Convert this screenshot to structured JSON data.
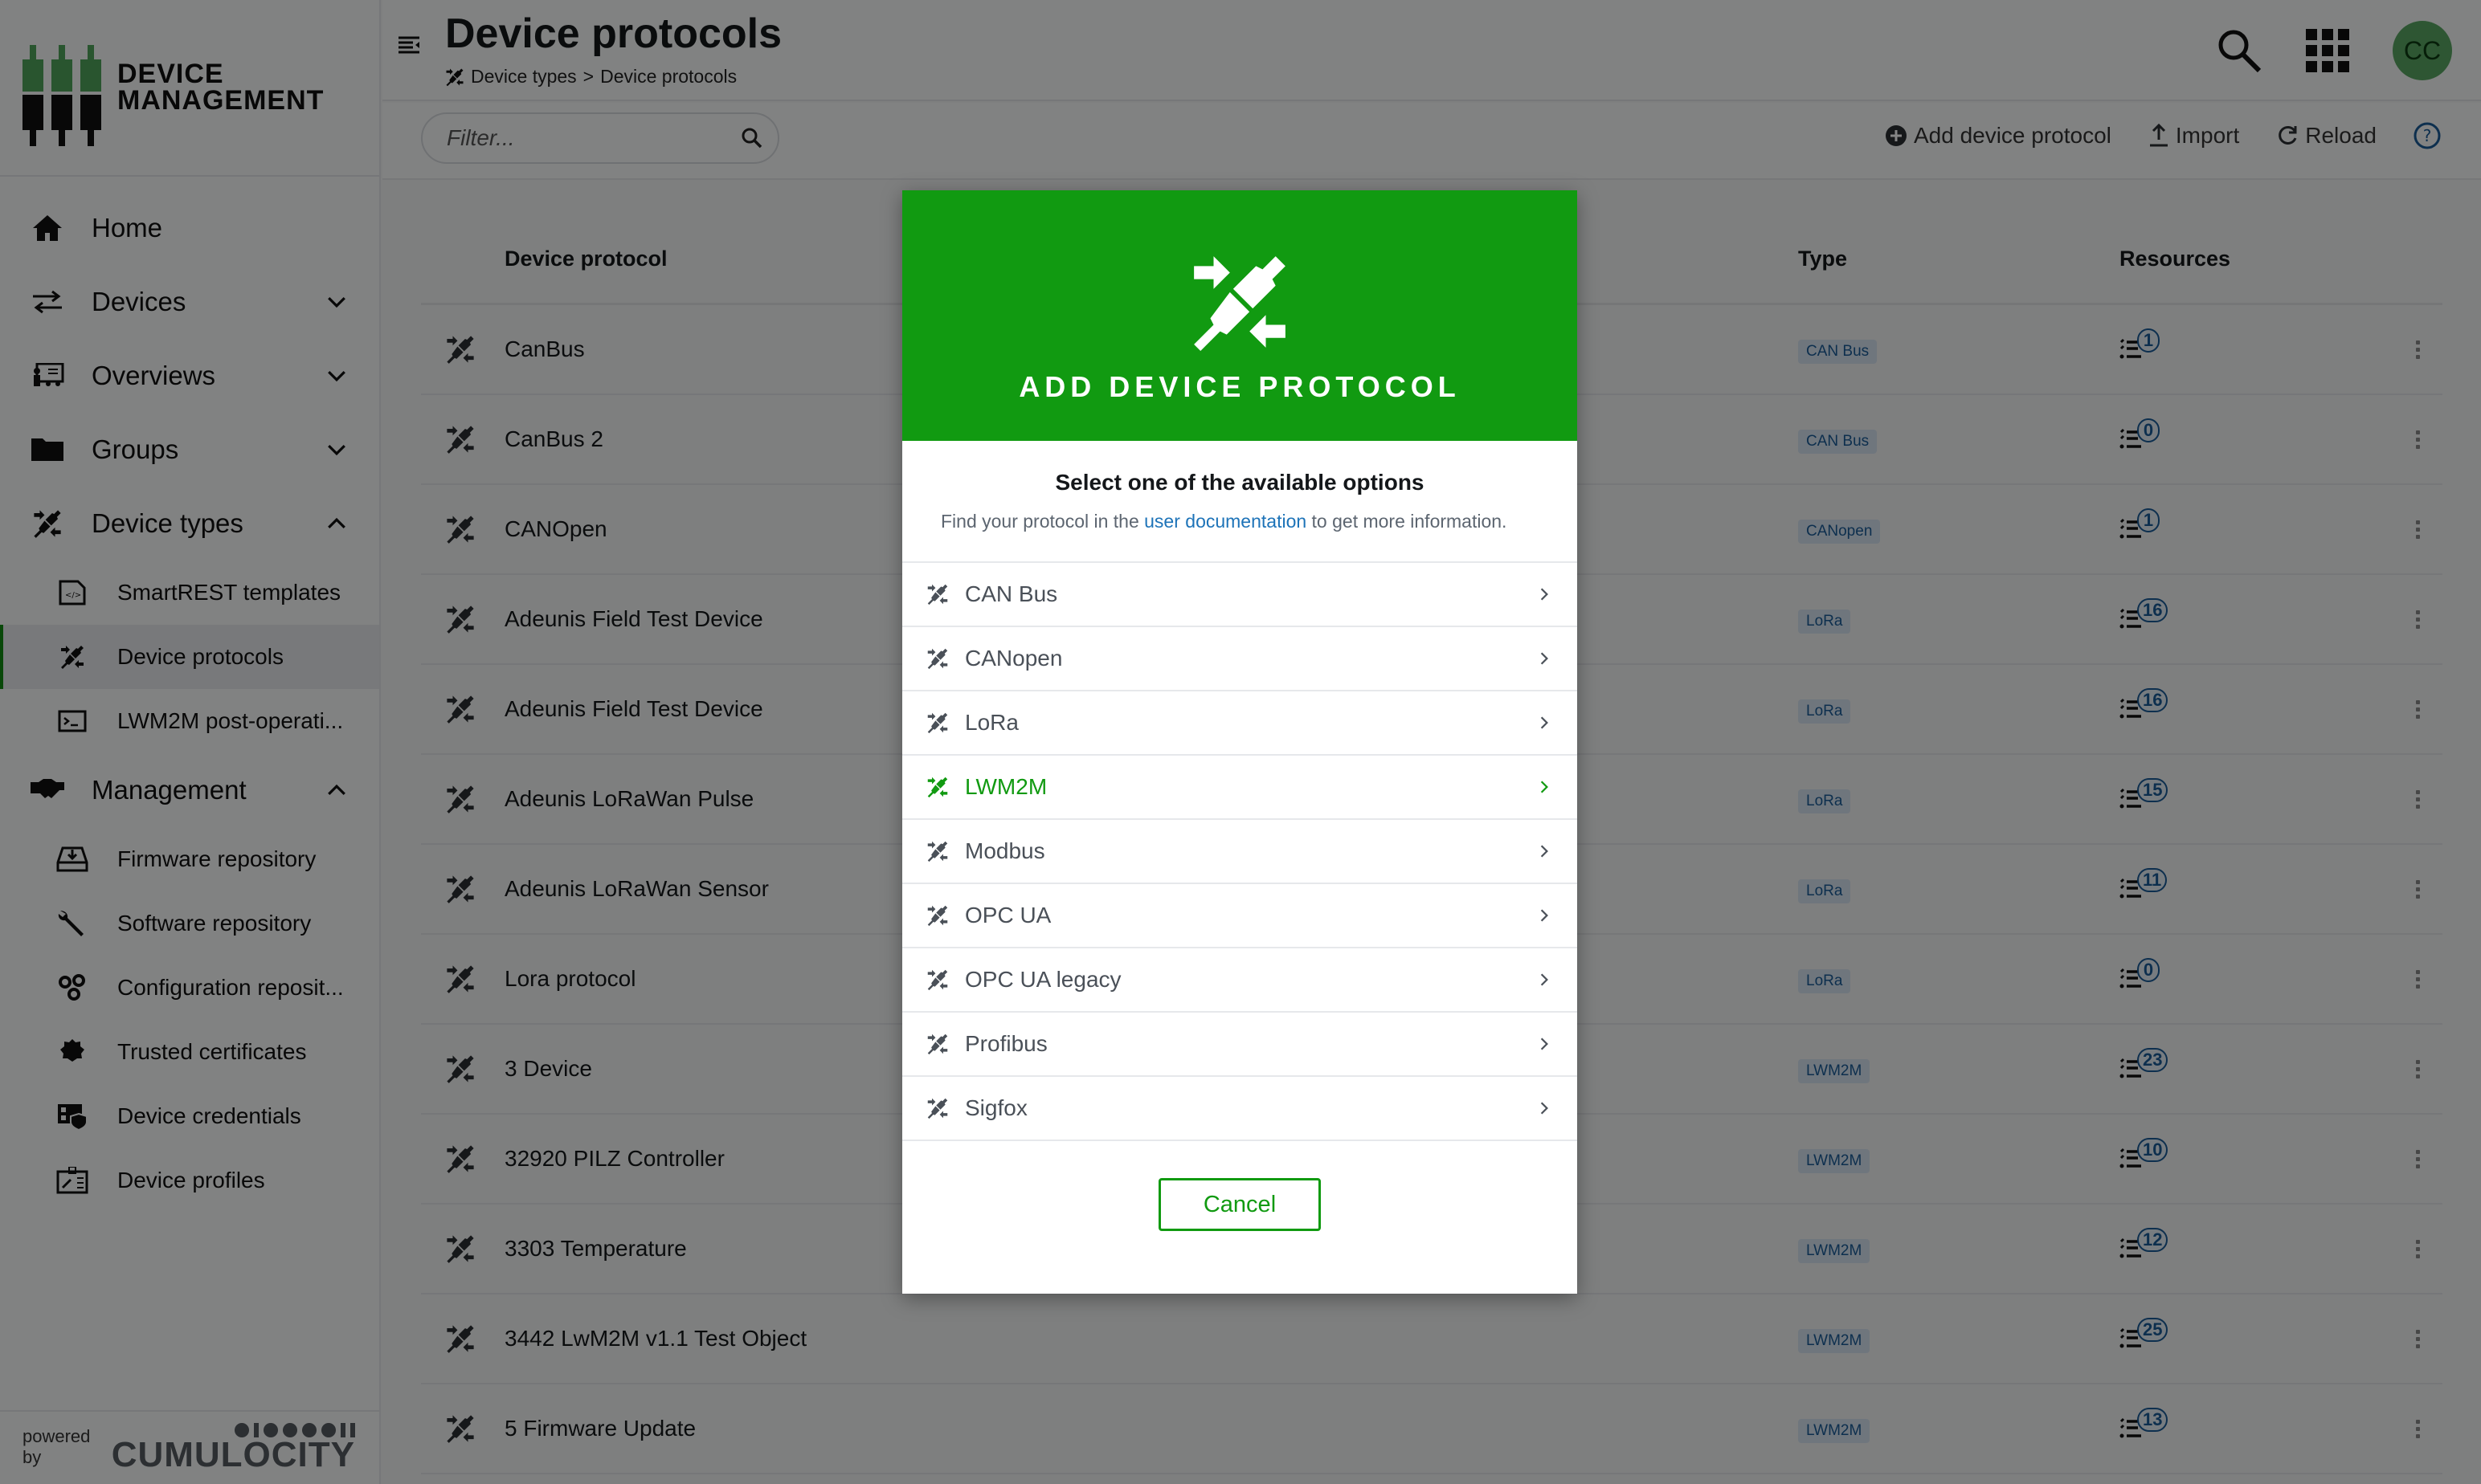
{
  "app": {
    "brand_line1": "DEVICE",
    "brand_line2": "MANAGEMENT",
    "powered_by": "powered by",
    "vendor": "CUMULOCITY"
  },
  "sidebar": {
    "items": [
      {
        "label": "Home",
        "icon": "home-icon"
      },
      {
        "label": "Devices",
        "icon": "exchange-icon",
        "expanded": false
      },
      {
        "label": "Overviews",
        "icon": "presentation-icon",
        "expanded": false
      },
      {
        "label": "Groups",
        "icon": "folder-icon",
        "expanded": false
      },
      {
        "label": "Device types",
        "icon": "plug-icon",
        "expanded": true
      }
    ],
    "device_types_children": [
      {
        "label": "SmartREST templates",
        "icon": "code-file-icon"
      },
      {
        "label": "Device protocols",
        "icon": "plug-icon",
        "active": true
      },
      {
        "label": "LWM2M post-operati...",
        "icon": "terminal-icon"
      }
    ],
    "management": {
      "label": "Management",
      "icon": "handshake-icon",
      "expanded": true
    },
    "management_children": [
      {
        "label": "Firmware repository",
        "icon": "hard-drive-download-icon"
      },
      {
        "label": "Software repository",
        "icon": "wrench-hand-icon"
      },
      {
        "label": "Configuration reposit...",
        "icon": "gears-icon"
      },
      {
        "label": "Trusted certificates",
        "icon": "certificate-icon"
      },
      {
        "label": "Device credentials",
        "icon": "credentials-shield-icon"
      },
      {
        "label": "Device profiles",
        "icon": "device-profile-icon"
      }
    ]
  },
  "header": {
    "title": "Device protocols",
    "breadcrumb_parent": "Device types",
    "breadcrumb_sep": ">",
    "breadcrumb_current": "Device protocols",
    "avatar_initials": "CC"
  },
  "actionbar": {
    "filter_placeholder": "Filter...",
    "add_label": "Add device protocol",
    "import_label": "Import",
    "reload_label": "Reload"
  },
  "table": {
    "columns": {
      "name": "Device protocol",
      "type": "Type",
      "resources": "Resources"
    },
    "rows": [
      {
        "name": "CanBus",
        "type": "CAN Bus",
        "resources": "1"
      },
      {
        "name": "CanBus 2",
        "type": "CAN Bus",
        "resources": "0"
      },
      {
        "name": "CANOpen",
        "type": "CANopen",
        "resources": "1"
      },
      {
        "name": "Adeunis Field Test Device",
        "type": "LoRa",
        "resources": "16"
      },
      {
        "name": "Adeunis Field Test Device",
        "type": "LoRa",
        "resources": "16"
      },
      {
        "name": "Adeunis LoRaWan Pulse",
        "type": "LoRa",
        "resources": "15"
      },
      {
        "name": "Adeunis LoRaWan Sensor",
        "type": "LoRa",
        "resources": "11"
      },
      {
        "name": "Lora protocol",
        "type": "LoRa",
        "resources": "0"
      },
      {
        "name": "3 Device",
        "type": "LWM2M",
        "resources": "23"
      },
      {
        "name": "32920 PILZ Controller",
        "type": "LWM2M",
        "resources": "10"
      },
      {
        "name": "3303 Temperature",
        "type": "LWM2M",
        "resources": "12"
      },
      {
        "name": "3442 LwM2M v1.1 Test Object",
        "type": "LWM2M",
        "resources": "25"
      },
      {
        "name": "5 Firmware Update",
        "type": "LWM2M",
        "resources": "13"
      }
    ]
  },
  "modal": {
    "title": "ADD DEVICE PROTOCOL",
    "intro_title": "Select one of the available options",
    "intro_pre": "Find your protocol in the ",
    "intro_link": "user documentation",
    "intro_post": " to get more information.",
    "options": [
      {
        "label": "CAN Bus"
      },
      {
        "label": "CANopen"
      },
      {
        "label": "LoRa"
      },
      {
        "label": "LWM2M",
        "highlighted": true
      },
      {
        "label": "Modbus"
      },
      {
        "label": "OPC UA"
      },
      {
        "label": "OPC UA legacy"
      },
      {
        "label": "Profibus"
      },
      {
        "label": "Sigfox"
      }
    ],
    "cancel_label": "Cancel"
  },
  "colors": {
    "brand_green": "#119a11",
    "link_blue": "#1d73b8",
    "badge_blue": "#1a5a96",
    "avatar_green": "#58a562"
  }
}
